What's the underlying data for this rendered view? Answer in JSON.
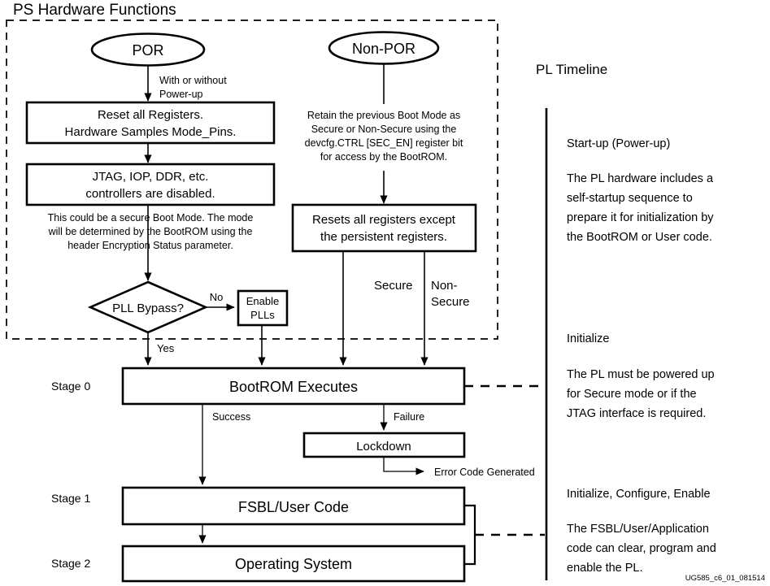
{
  "diagram": {
    "ps_region_title": "PS Hardware Functions",
    "footer_id": "UG585_c6_01_081514"
  },
  "ps_flow": {
    "por_node": "POR",
    "nonpor_node": "Non-POR",
    "por_edge_label_line1": "With or without",
    "por_edge_label_line2": "Power-up",
    "reset_registers_line1": "Reset all Registers.",
    "reset_registers_line2": "Hardware Samples Mode_Pins.",
    "controllers_disabled_line1": "JTAG, IOP, DDR, etc.",
    "controllers_disabled_line2": "controllers are disabled.",
    "secure_boot_note_line1": "This could be a secure Boot Mode. The mode",
    "secure_boot_note_line2": "will be determined by the BootROM using the",
    "secure_boot_note_line3": "header Encryption Status parameter.",
    "nonpor_note_line1": "Retain the previous Boot Mode as",
    "nonpor_note_line2": "Secure or Non-Secure using the",
    "nonpor_note_line3": "devcfg.CTRL [SEC_EN] register bit",
    "nonpor_note_line4": "for access by the BootROM.",
    "resets_persistent_line1": "Resets all registers except",
    "resets_persistent_line2": "the persistent registers.",
    "pll_bypass_decision": "PLL Bypass?",
    "pll_bypass_no": "No",
    "pll_bypass_yes": "Yes",
    "enable_plls_line1": "Enable",
    "enable_plls_line2": "PLLs",
    "secure_label": "Secure",
    "nonsecure_label_line1": "Non-",
    "nonsecure_label_line2": "Secure"
  },
  "stages": {
    "stage0_label": "Stage 0",
    "stage1_label": "Stage 1",
    "stage2_label": "Stage 2",
    "bootrom": "BootROM Executes",
    "fsbl": "FSBL/User Code",
    "os": "Operating System",
    "lockdown": "Lockdown",
    "success_label": "Success",
    "failure_label": "Failure",
    "error_code_label": "Error Code Generated"
  },
  "pl_timeline": {
    "heading": "PL Timeline",
    "sections": [
      {
        "title": "Start-up (Power-up)",
        "body": [
          "The PL hardware includes a",
          "self-startup sequence to",
          "prepare it for initialization by",
          "the BootROM or User code."
        ]
      },
      {
        "title": "Initialize",
        "body": [
          "The PL must be powered up",
          "for Secure mode or if the",
          "JTAG interface is required."
        ]
      },
      {
        "title": "Initialize, Configure, Enable",
        "body": [
          "The FSBL/User/Application",
          "code can clear, program and",
          "enable the PL."
        ]
      }
    ]
  }
}
